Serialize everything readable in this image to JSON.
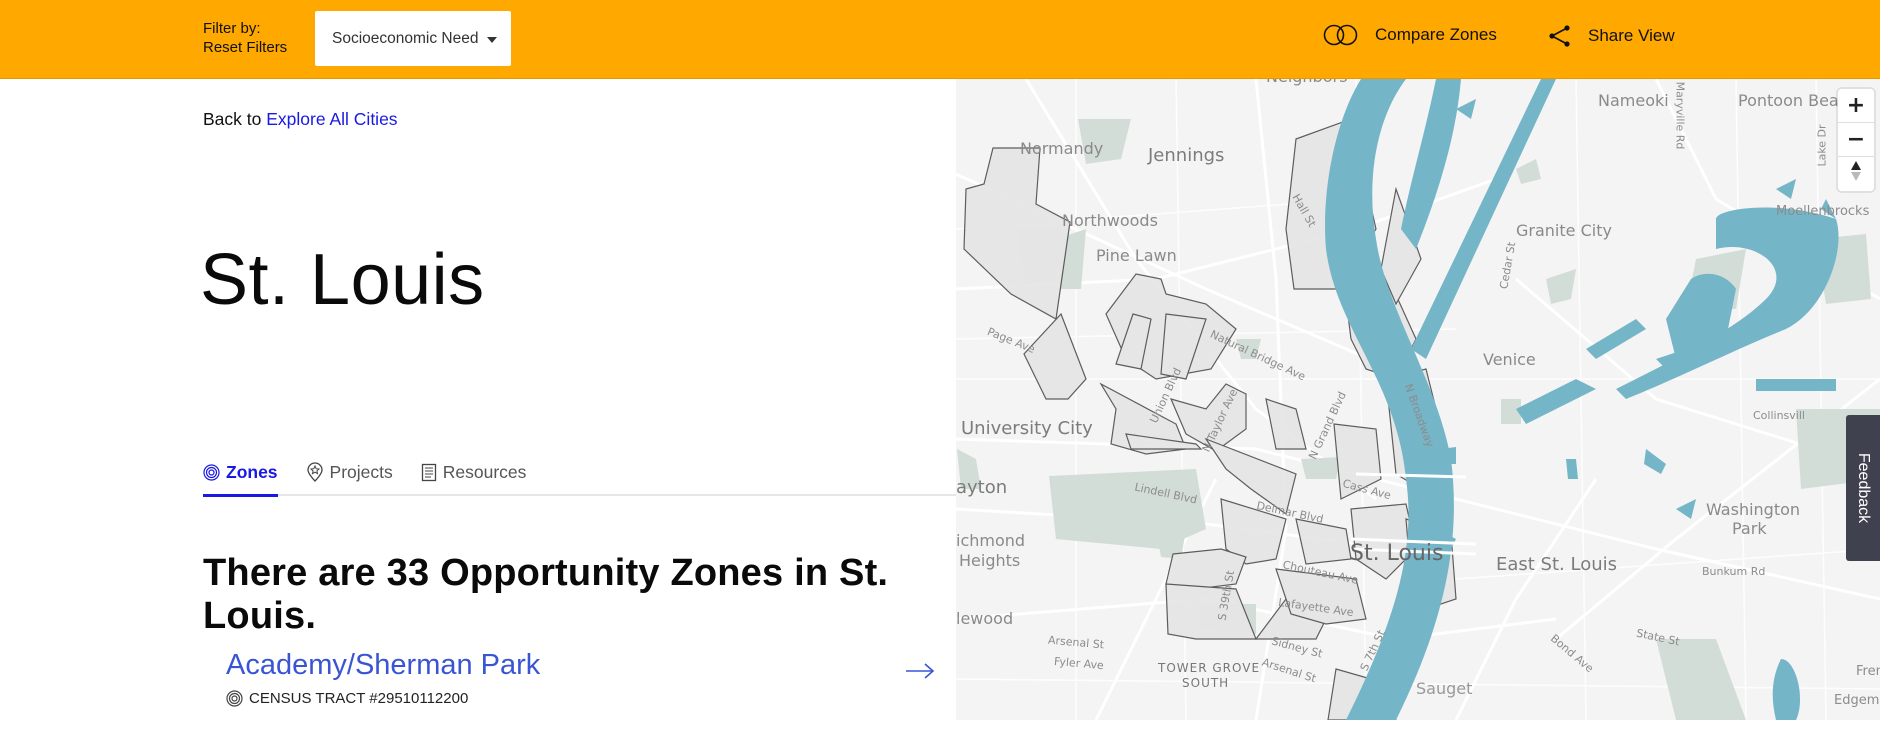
{
  "topbar": {
    "filter_by_label": "Filter by:",
    "reset_filters_label": "Reset Filters",
    "filter_dropdown_value": "Socioeconomic Need",
    "compare_zones_label": "Compare Zones",
    "share_view_label": "Share View",
    "background_color": "#FFA800"
  },
  "left_panel": {
    "back_prefix": "Back to",
    "back_link_label": "Explore All Cities",
    "city_title": "St. Louis",
    "tabs": [
      {
        "label": "Zones",
        "icon": "target-icon",
        "active": true
      },
      {
        "label": "Projects",
        "icon": "map-pin-star-icon",
        "active": false
      },
      {
        "label": "Resources",
        "icon": "document-icon",
        "active": false
      }
    ],
    "zone_count_text": "There are 33 Opportunity Zones in St. Louis.",
    "zones": [
      {
        "name": "Academy/Sherman Park",
        "tract": "CENSUS TRACT #29510112200"
      }
    ],
    "accent_color": "#1919E6",
    "zone_link_color": "#3A55D4"
  },
  "map": {
    "labels": {
      "neighbors": "Neighbors",
      "normandy": "Normandy",
      "jennings": "Jennings",
      "northwoods": "Northwoods",
      "pine_lawn": "Pine Lawn",
      "page_ave": "Page Ave",
      "university_city": "University City",
      "clayton": "ayton",
      "richmond": "ichmond",
      "heights": "Heights",
      "maplewood": "lewood",
      "hall_st": "Hall St",
      "natural_bridge": "Natural Bridge Ave",
      "union_blvd": "Union Blvd",
      "n_taylor": "N Taylor Ave",
      "n_grand": "N Grand Blvd",
      "n_broadway": "N Broadway",
      "cass_ave": "Cass Ave",
      "lindell": "Lindell Blvd",
      "delmar": "Delmar Blvd",
      "st_louis": "St. Louis",
      "chouteau": "Chouteau Ave",
      "lafayette": "Lafayette Ave",
      "s_39th": "S 39th St",
      "arsenal": "Arsenal St",
      "arsenal2": "Arsenal St",
      "fyler": "Fyler Ave",
      "sidney": "Sidney St",
      "s_7th": "S 7th St",
      "tower_grove": "TOWER GROVE",
      "south": "SOUTH",
      "sauget": "Sauget",
      "nameoki": "Nameoki",
      "maryville": "Maryville Rd",
      "pontoon": "Pontoon Beac",
      "lake_dr": "Lake Dr",
      "moellenbrocks": "Moellenbrocks",
      "granite_city": "Granite City",
      "cedar_st": "Cedar St",
      "venice": "Venice",
      "collinsville": "Collinsvill",
      "washington": "Washington",
      "park": "Park",
      "east_st_louis": "East St. Louis",
      "bunkum": "Bunkum Rd",
      "state_st": "State St",
      "bond_ave": "Bond Ave",
      "frem": "Frem",
      "edgemont": "Edgemon"
    },
    "zoom_in_label": "+",
    "zoom_out_label": "−",
    "water_color": "#75B5C8",
    "park_color": "#D3DDD7",
    "zone_fill_color": "#E6E6E6",
    "zone_stroke_color": "#555555"
  },
  "feedback_label": "Feedback"
}
